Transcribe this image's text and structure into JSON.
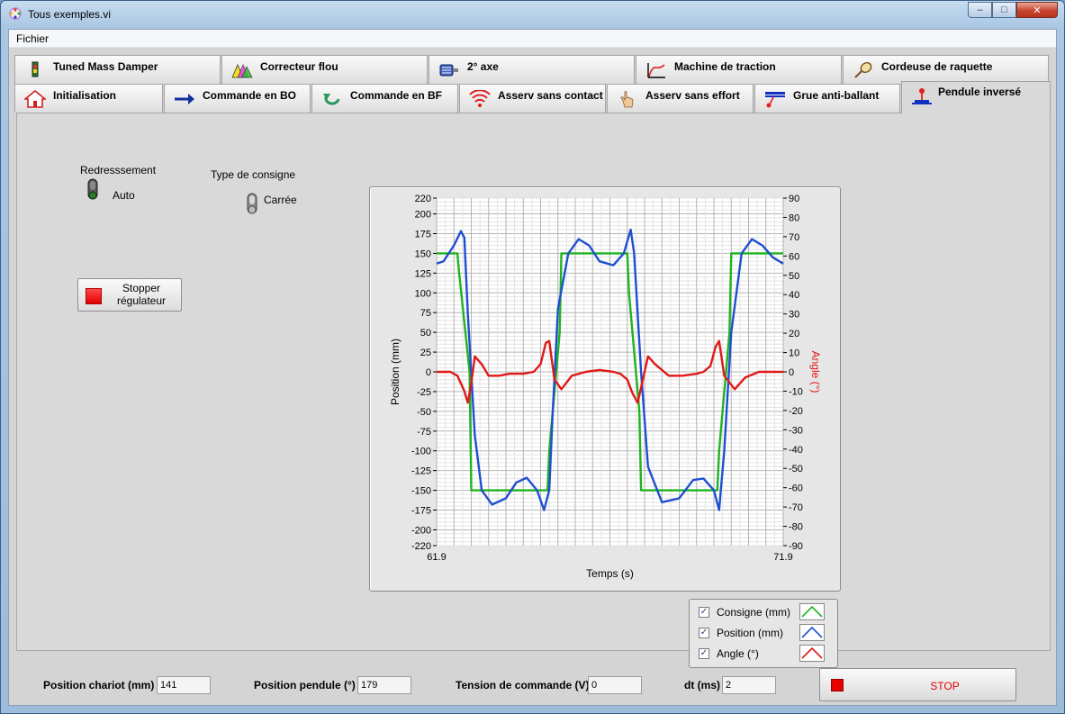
{
  "window": {
    "title": "Tous exemples.vi"
  },
  "menu": {
    "fichier": "Fichier"
  },
  "tabs_row1": [
    {
      "label": "Tuned Mass Damper",
      "icon": "tuned-mass-damper-icon"
    },
    {
      "label": "Correcteur flou",
      "icon": "fuzzy-triangles-icon"
    },
    {
      "label": "2° axe",
      "icon": "motor-icon"
    },
    {
      "label": "Machine de traction",
      "icon": "traction-curve-icon"
    },
    {
      "label": "Cordeuse de raquette",
      "icon": "racket-icon"
    }
  ],
  "tabs_row2": [
    {
      "label": "Initialisation",
      "icon": "home-icon"
    },
    {
      "label": "Commande en BO",
      "icon": "arrow-right-icon"
    },
    {
      "label": "Commande en BF",
      "icon": "loop-arrow-icon"
    },
    {
      "label": "Asserv sans contact",
      "icon": "wireless-icon"
    },
    {
      "label": "Asserv sans effort",
      "icon": "hand-icon"
    },
    {
      "label": "Grue anti-ballant",
      "icon": "crane-icon"
    },
    {
      "label": "Pendule inversé",
      "icon": "pendulum-icon",
      "active": true
    }
  ],
  "controls": {
    "redressement_label": "Redresssement",
    "redressement_value": "Auto",
    "consigne_label": "Type de consigne",
    "consigne_value": "Carrée",
    "stop_regulator": [
      "Stopper",
      "régulateur"
    ]
  },
  "chart_data": {
    "type": "line",
    "xlabel": "Temps (s)",
    "ylabel": "Position (mm)",
    "y2label": "Angle (°)",
    "xlim": [
      61.9,
      71.9
    ],
    "x_ticks": [
      "61.9",
      "71.9"
    ],
    "ylim": [
      -220,
      220
    ],
    "y_ticks": [
      220,
      200,
      175,
      150,
      125,
      100,
      75,
      50,
      25,
      0,
      -25,
      -50,
      -75,
      -100,
      -125,
      -150,
      -175,
      -200,
      -220
    ],
    "y2lim": [
      -90,
      90
    ],
    "y2_ticks": [
      90,
      80,
      70,
      60,
      50,
      40,
      30,
      20,
      10,
      0,
      -10,
      -20,
      -30,
      -40,
      -50,
      -60,
      -70,
      -80,
      -90
    ],
    "grid": true,
    "colors": {
      "consigne": "#1fb31f",
      "position": "#1f4fd0",
      "angle": "#e01818"
    },
    "series": [
      {
        "name": "Consigne (mm)",
        "axis": "left",
        "x": [
          61.9,
          62.5,
          62.55,
          62.85,
          62.9,
          65.1,
          65.15,
          65.45,
          65.5,
          67.4,
          67.45,
          67.75,
          67.8,
          70.0,
          70.05,
          70.35,
          70.4,
          71.9
        ],
        "y": [
          150,
          150,
          125,
          0,
          -150,
          -150,
          -100,
          50,
          150,
          150,
          100,
          -50,
          -150,
          -150,
          -100,
          50,
          150,
          150
        ]
      },
      {
        "name": "Position (mm)",
        "axis": "left",
        "x": [
          61.9,
          62.1,
          62.4,
          62.6,
          62.7,
          62.8,
          63.0,
          63.2,
          63.5,
          63.9,
          64.2,
          64.5,
          64.8,
          65.0,
          65.15,
          65.25,
          65.4,
          65.7,
          66.0,
          66.3,
          66.6,
          67.0,
          67.3,
          67.5,
          67.6,
          67.8,
          68.0,
          68.4,
          68.9,
          69.3,
          69.6,
          69.9,
          70.05,
          70.2,
          70.4,
          70.7,
          71.0,
          71.3,
          71.6,
          71.9
        ],
        "y": [
          137,
          140,
          160,
          178,
          170,
          75,
          -80,
          -150,
          -168,
          -160,
          -140,
          -134,
          -150,
          -175,
          -150,
          -50,
          80,
          150,
          168,
          160,
          140,
          135,
          150,
          180,
          150,
          0,
          -120,
          -165,
          -160,
          -137,
          -135,
          -150,
          -175,
          -100,
          50,
          150,
          168,
          160,
          145,
          137
        ]
      },
      {
        "name": "Angle (°)",
        "axis": "right",
        "x": [
          61.9,
          62.3,
          62.5,
          62.7,
          62.8,
          62.9,
          63.0,
          63.2,
          63.4,
          63.7,
          64.0,
          64.4,
          64.7,
          64.9,
          65.05,
          65.15,
          65.3,
          65.5,
          65.8,
          66.2,
          66.6,
          67.0,
          67.2,
          67.4,
          67.55,
          67.7,
          67.85,
          68.0,
          68.2,
          68.6,
          69.0,
          69.4,
          69.6,
          69.8,
          69.95,
          70.05,
          70.2,
          70.5,
          70.8,
          71.2,
          71.9
        ],
        "y": [
          0,
          0,
          -2,
          -10,
          -16,
          -6,
          8,
          4,
          -2,
          -2,
          -1,
          -1,
          0,
          4,
          15,
          16,
          -4,
          -9,
          -2,
          0,
          1,
          0,
          -1,
          -4,
          -11,
          -16,
          -4,
          8,
          4,
          -2,
          -2,
          -1,
          0,
          3,
          13,
          16,
          -2,
          -9,
          -3,
          0,
          0
        ]
      }
    ]
  },
  "legend": [
    {
      "label": "Consigne (mm)",
      "checked": true,
      "color": "#1fb31f"
    },
    {
      "label": "Position (mm)",
      "checked": true,
      "color": "#1f4fd0"
    },
    {
      "label": "Angle (°)",
      "checked": true,
      "color": "#e01818"
    }
  ],
  "status": {
    "pos_chariot_label": "Position chariot (mm)",
    "pos_chariot_value": "141",
    "pos_pendule_label": "Position pendule (°)",
    "pos_pendule_value": "179",
    "tension_label": "Tension de commande (V)",
    "tension_value": "0",
    "dt_label": "dt (ms)",
    "dt_value": "2",
    "stop_label": "STOP"
  }
}
